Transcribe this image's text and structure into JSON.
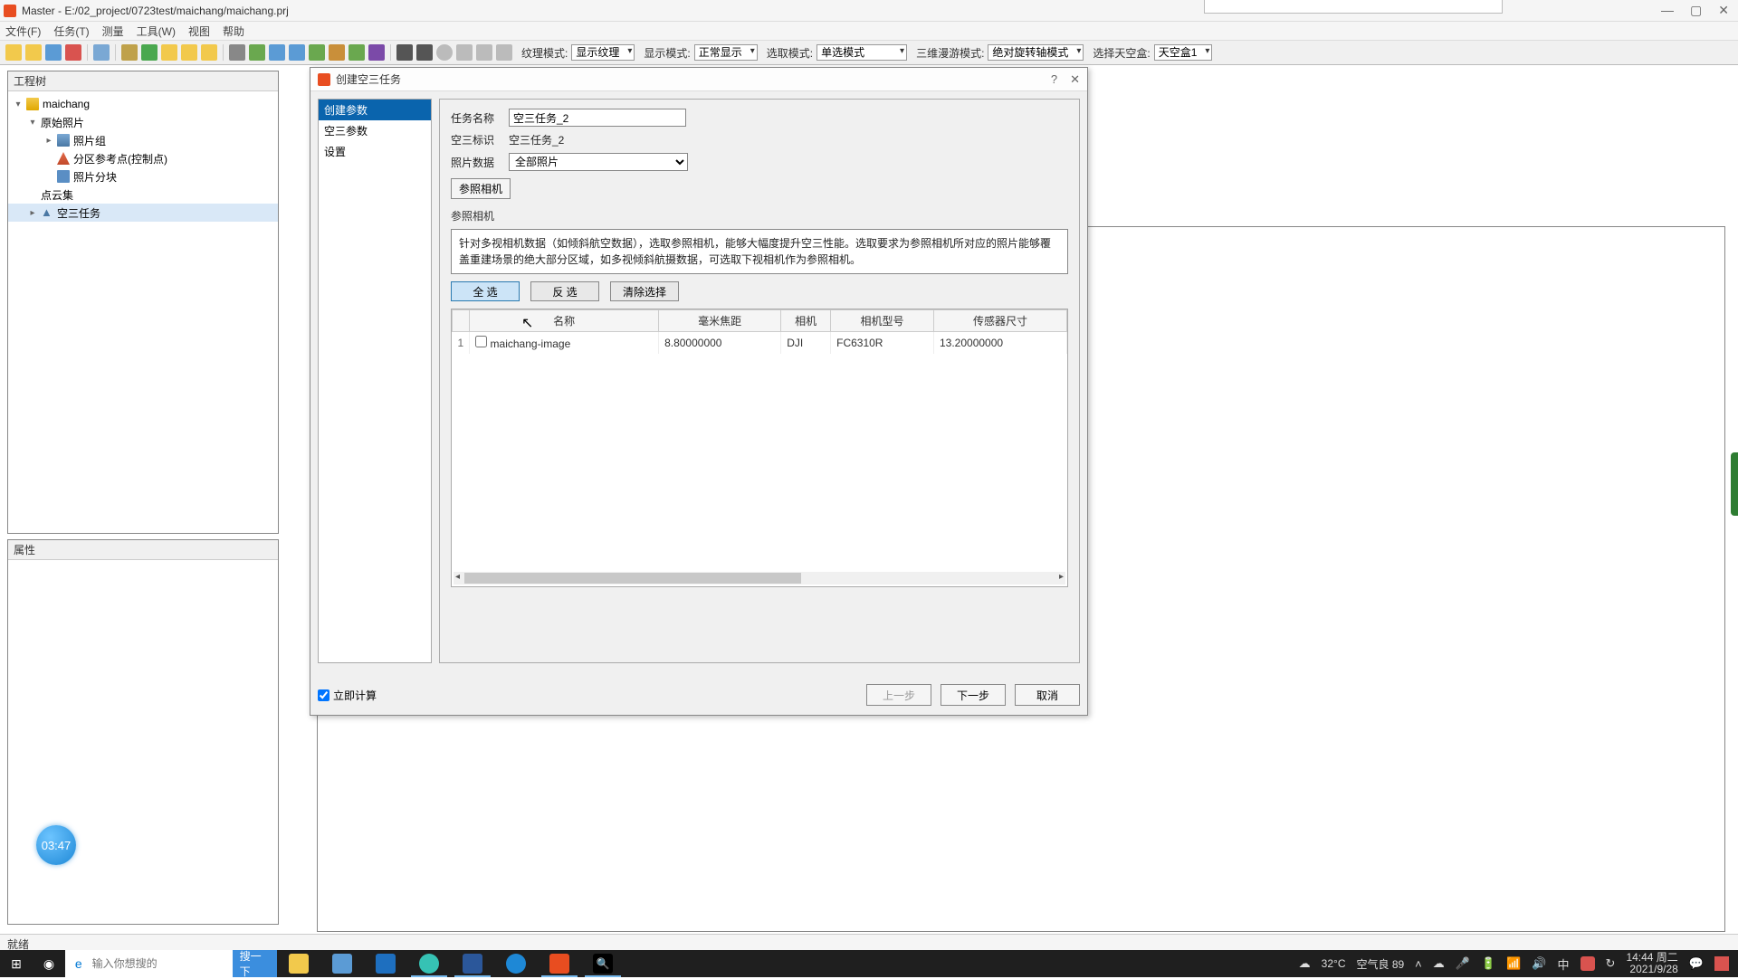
{
  "window": {
    "title": "Master - E:/02_project/0723test/maichang/maichang.prj",
    "minimize": "—",
    "maximize": "▢",
    "close": "✕"
  },
  "menu": [
    "文件(F)",
    "任务(T)",
    "测量",
    "工具(W)",
    "视图",
    "帮助"
  ],
  "toolbar": {
    "labels": {
      "texture": "纹理模式:",
      "display": "显示模式:",
      "select": "选取模式:",
      "roam": "三维漫游模式:",
      "sky": "选择天空盒:"
    },
    "values": {
      "texture": "显示纹理",
      "display": "正常显示",
      "select": "单选模式",
      "roam": "绝对旋转轴模式",
      "sky": "天空盒1"
    }
  },
  "tree": {
    "title": "工程树",
    "root": "maichang",
    "nodes": {
      "raw": "原始照片",
      "photogroup": "照片组",
      "ctrl": "分区参考点(控制点)",
      "block": "照片分块",
      "pointcloud": "点云集",
      "at": "空三任务"
    }
  },
  "prop": {
    "title": "属性"
  },
  "dialog": {
    "title": "创建空三任务",
    "nav": [
      "创建参数",
      "空三参数",
      "设置"
    ],
    "form": {
      "name_label": "任务名称",
      "name_value": "空三任务_2",
      "id_label": "空三标识",
      "id_value": "空三任务_2",
      "data_label": "照片数据",
      "data_value": "全部照片",
      "ref_btn": "参照相机"
    },
    "ref": {
      "title": "参照相机",
      "desc": "针对多视相机数据（如倾斜航空数据），选取参照相机，能够大幅度提升空三性能。选取要求为参照相机所对应的照片能够覆盖重建场景的绝大部分区域，如多视倾斜航摄数据，可选取下视相机作为参照相机。",
      "btn_all": "全 选",
      "btn_inv": "反 选",
      "btn_clr": "清除选择"
    },
    "table": {
      "cols": [
        "名称",
        "毫米焦距",
        "相机",
        "相机型号",
        "传感器尺寸"
      ],
      "rows": [
        {
          "idx": "1",
          "name": "maichang-image",
          "focal": "8.80000000",
          "cam": "DJI",
          "model": "FC6310R",
          "sensor": "13.20000000"
        }
      ]
    },
    "foot": {
      "calc": "立即计算",
      "prev": "上一步",
      "next": "下一步",
      "cancel": "取消"
    }
  },
  "status": {
    "ready": "就绪"
  },
  "timer": "03:47",
  "taskbar": {
    "search_placeholder": "输入你想搜的",
    "search_go": "搜一下",
    "weather_temp": "32°C",
    "weather_txt": "空气良 89",
    "time": "14:44 周二",
    "date": "2021/9/28"
  }
}
